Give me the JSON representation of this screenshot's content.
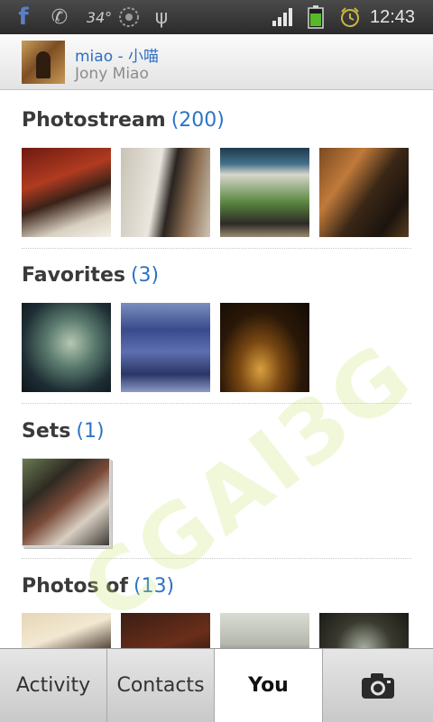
{
  "status_bar": {
    "facebook_icon": "facebook-icon",
    "temperature": "34°",
    "time": "12:43",
    "battery_level": "69",
    "icons": [
      "facebook-icon",
      "phone-icon",
      "wifi-icon",
      "usb-icon",
      "signal-icon",
      "battery-icon",
      "alarm-icon"
    ]
  },
  "account": {
    "name": "miao - 小喵",
    "subtitle": "Jony Miao"
  },
  "sections": {
    "photostream": {
      "title": "Photostream",
      "count": "(200)"
    },
    "favorites": {
      "title": "Favorites",
      "count": "(3)"
    },
    "sets": {
      "title": "Sets",
      "count": "(1)"
    },
    "photos_of": {
      "title": "Photos of",
      "count": "(13)"
    }
  },
  "tabs": {
    "activity": "Activity",
    "contacts": "Contacts",
    "you": "You",
    "camera_icon": "camera-icon"
  },
  "watermark": "CGAI3G",
  "colors": {
    "link_blue": "#2c6ec2",
    "count_blue": "#2d74c7",
    "status_bar": "#2b2b2b",
    "tab_active": "#ffffff"
  }
}
